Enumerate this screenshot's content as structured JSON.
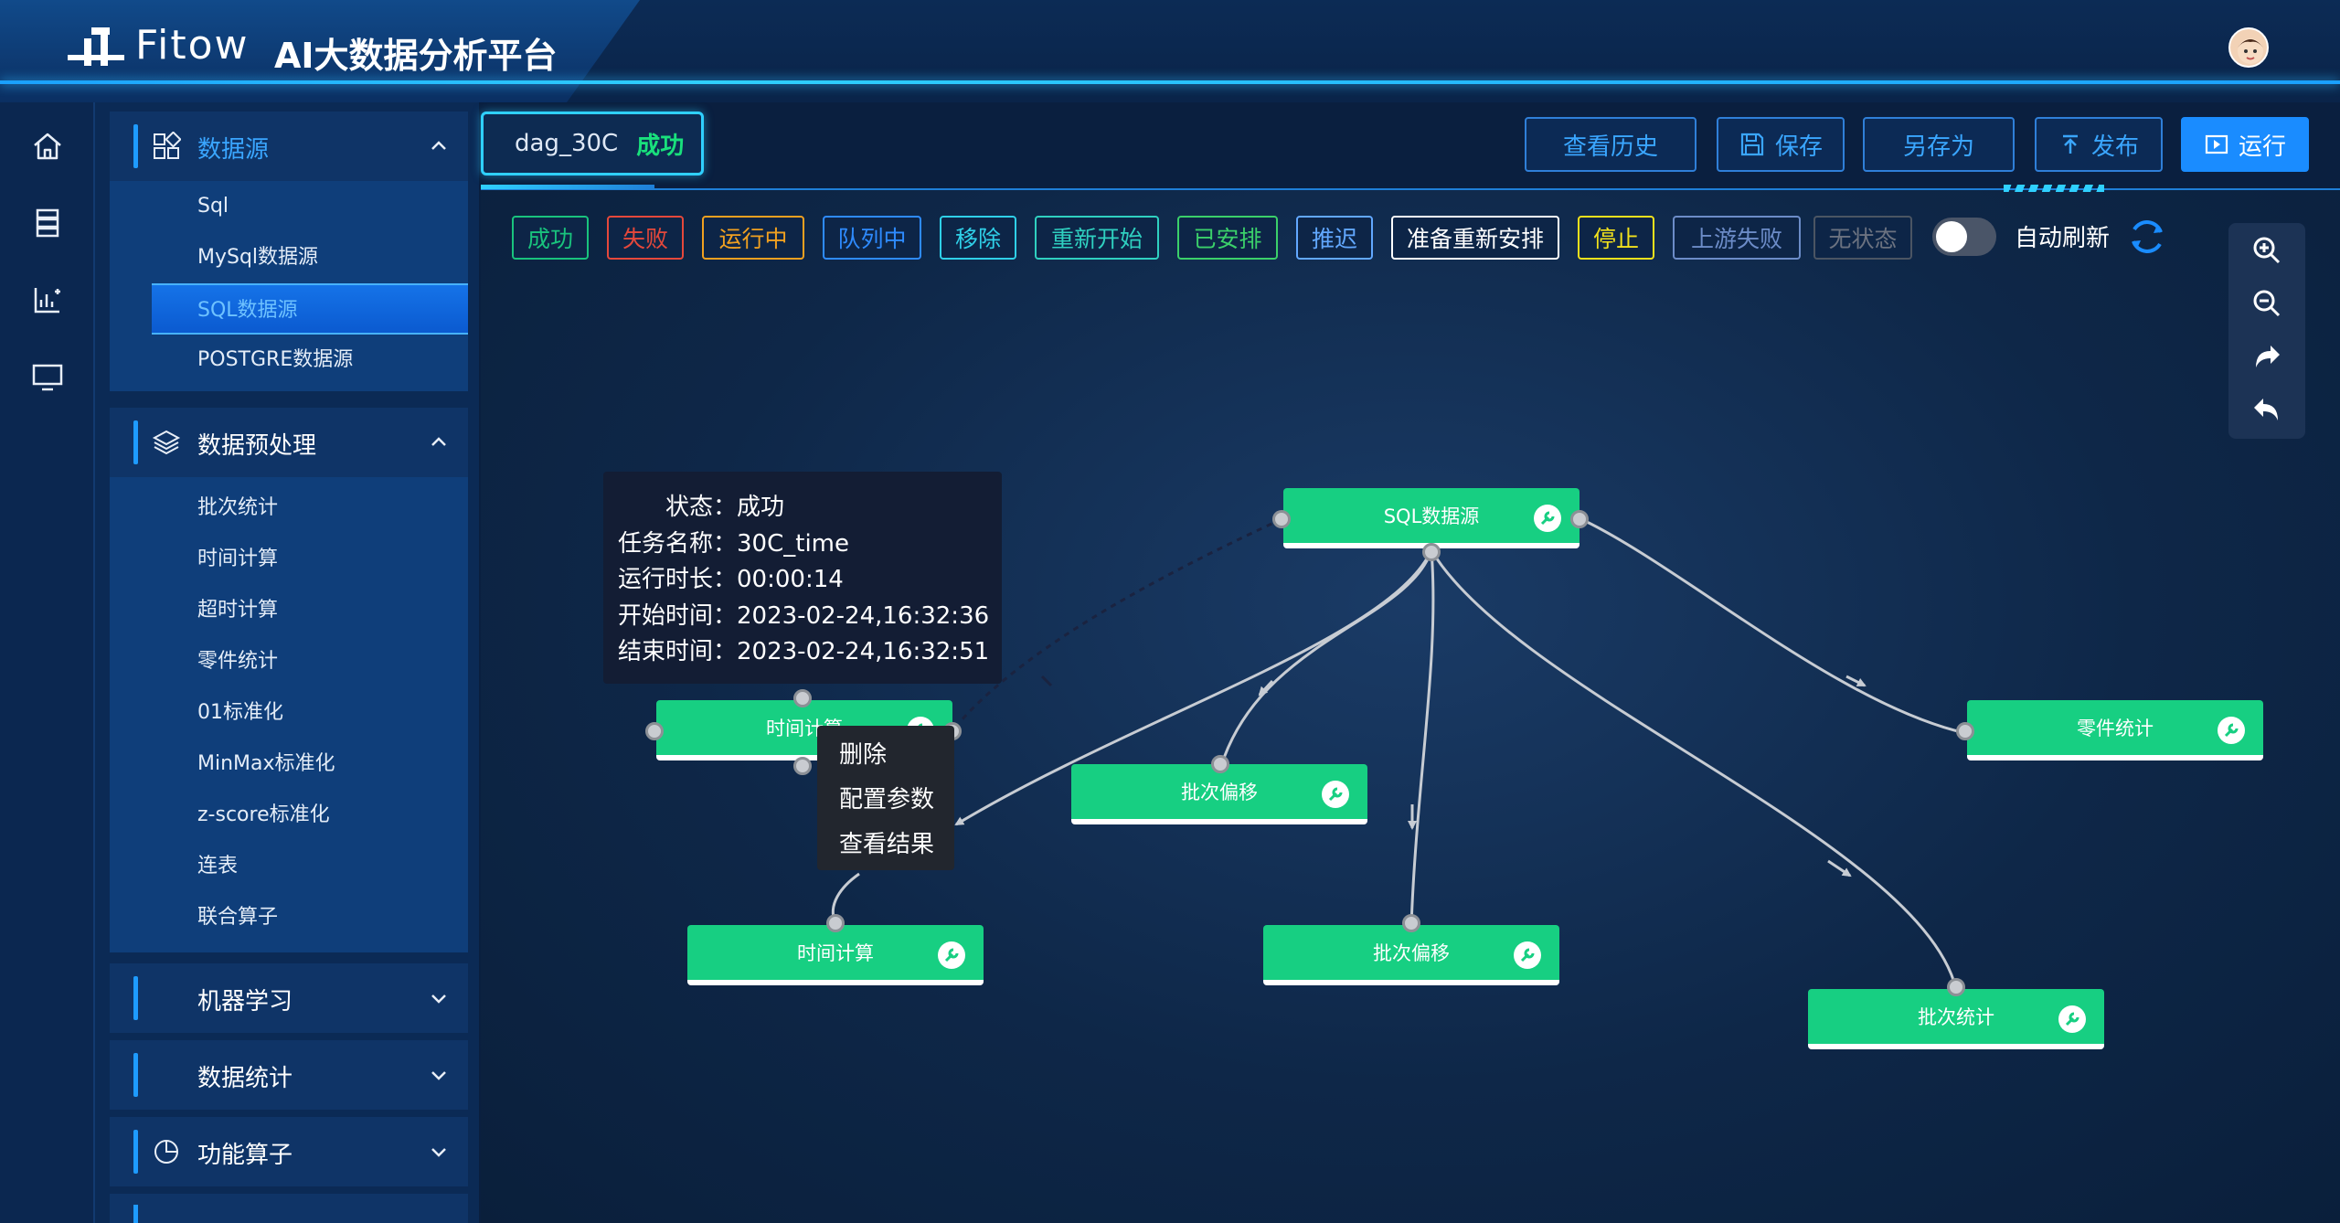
{
  "header": {
    "logo_text": "Fitow",
    "app_title": "AI大数据分析平台",
    "avatar": "user-avatar"
  },
  "rail": {
    "icons": [
      "home-icon",
      "database-icon",
      "chart-icon",
      "monitor-icon"
    ]
  },
  "menu": {
    "groups": [
      {
        "label": "数据源",
        "icon": "grid-icon",
        "expanded": true,
        "items": [
          {
            "label": "Sql"
          },
          {
            "label": "MySql数据源"
          },
          {
            "label": "SQL数据源",
            "active": true
          },
          {
            "label": "POSTGRE数据源"
          }
        ]
      },
      {
        "label": "数据预处理",
        "icon": "layers-icon",
        "expanded": true,
        "items": [
          {
            "label": "批次统计"
          },
          {
            "label": "时间计算"
          },
          {
            "label": "超时计算"
          },
          {
            "label": "零件统计"
          },
          {
            "label": "01标准化"
          },
          {
            "label": "MinMax标准化"
          },
          {
            "label": "z-score标准化"
          },
          {
            "label": "连表"
          },
          {
            "label": "联合算子"
          }
        ]
      },
      {
        "label": "机器学习",
        "expanded": false
      },
      {
        "label": "数据统计",
        "expanded": false
      },
      {
        "label": "功能算子",
        "icon": "pie-icon",
        "expanded": false
      }
    ]
  },
  "tab": {
    "name": "dag_30C",
    "status": "成功"
  },
  "toolbar": {
    "history": "查看历史",
    "save": "保存",
    "save_as": "另存为",
    "publish": "发布",
    "run": "运行"
  },
  "status_tags": [
    {
      "label": "成功",
      "color": "#19c37d"
    },
    {
      "label": "失败",
      "color": "#e5483b"
    },
    {
      "label": "运行中",
      "color": "#f0a020"
    },
    {
      "label": "队列中",
      "color": "#2e8bff"
    },
    {
      "label": "移除",
      "color": "#2fd0e8"
    },
    {
      "label": "重新开始",
      "color": "#2fd0c0"
    },
    {
      "label": "已安排",
      "color": "#3bd06a"
    },
    {
      "label": "推迟",
      "color": "#62a8ff"
    },
    {
      "label": "准备重新安排",
      "color": "#ffffff"
    },
    {
      "label": "停止",
      "color": "#f2e11c"
    },
    {
      "label": "上游失败",
      "color": "#6c8cc8"
    },
    {
      "label": "无状态",
      "color": "#6b7280"
    }
  ],
  "auto_refresh": {
    "label": "自动刷新",
    "on": false
  },
  "zoom_tools": [
    "zoom-in-icon",
    "zoom-out-icon",
    "redo-icon",
    "undo-icon"
  ],
  "nodes": [
    {
      "id": "sql",
      "label": "SQL数据源"
    },
    {
      "id": "time1",
      "label": "时间计算"
    },
    {
      "id": "batch_offset1",
      "label": "批次偏移"
    },
    {
      "id": "part_stats",
      "label": "零件统计"
    },
    {
      "id": "time2",
      "label": "时间计算"
    },
    {
      "id": "batch_offset2",
      "label": "批次偏移"
    },
    {
      "id": "batch_stats",
      "label": "批次统计"
    }
  ],
  "tooltip": {
    "status_label": "状态：",
    "status": "成功",
    "task_label": "任务名称：",
    "task": "30C_time",
    "duration_label": "运行时长：",
    "duration": "00:00:14",
    "start_label": "开始时间：",
    "start": "2023-02-24,16:32:36",
    "end_label": "结束时间：",
    "end": "2023-02-24,16:32:51"
  },
  "context_menu": [
    "删除",
    "配置参数",
    "查看结果"
  ]
}
